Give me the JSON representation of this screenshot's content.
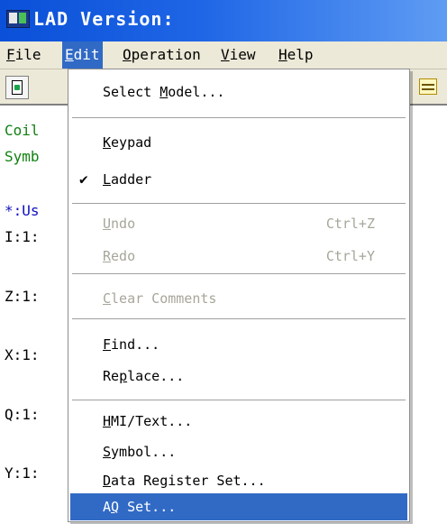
{
  "window": {
    "title": "LAD Version:",
    "icon": "lad-app-icon"
  },
  "menubar": {
    "items": [
      {
        "label": "File",
        "accel": "F",
        "rest": "ile"
      },
      {
        "label": "Edit",
        "accel": "E",
        "rest": "dit"
      },
      {
        "label": "Operation",
        "accel": "O",
        "rest": "peration"
      },
      {
        "label": "View",
        "accel": "V",
        "rest": "iew"
      },
      {
        "label": "Help",
        "accel": "H",
        "rest": "elp"
      }
    ],
    "active": "Edit"
  },
  "editor": {
    "lines": [
      "Coil",
      "Symb",
      "*:Us",
      "I:1:",
      "Z:1:",
      "X:1:",
      "Q:1:",
      "Y:1:"
    ]
  },
  "edit_menu": {
    "select_model": {
      "pre": "Select ",
      "accel": "M",
      "post": "odel..."
    },
    "keypad": {
      "accel": "K",
      "post": "eypad"
    },
    "ladder": {
      "accel": "L",
      "post": "adder",
      "check": "✔"
    },
    "undo": {
      "accel": "U",
      "post": "ndo",
      "shortcut": "Ctrl+Z"
    },
    "redo": {
      "accel": "R",
      "post": "edo",
      "shortcut": "Ctrl+Y"
    },
    "clear_comments": {
      "accel": "C",
      "post": "lear Comments"
    },
    "find": {
      "accel": "F",
      "post": "ind..."
    },
    "replace": {
      "pre": "Re",
      "accel": "p",
      "post": "lace..."
    },
    "hmi_text": {
      "accel": "H",
      "post": "MI/Text..."
    },
    "symbol": {
      "accel": "S",
      "post": "ymbol..."
    },
    "data_register_set": {
      "accel": "D",
      "post": "ata Register Set..."
    },
    "aq_set": {
      "pre": "A",
      "accel": "Q",
      "post": " Set..."
    }
  },
  "colors": {
    "titlebar": "#0a50d8",
    "menu_highlight": "#316ac5",
    "disabled_text": "#a7a69a",
    "editor_green": "#108010",
    "editor_blue": "#1010c0"
  }
}
